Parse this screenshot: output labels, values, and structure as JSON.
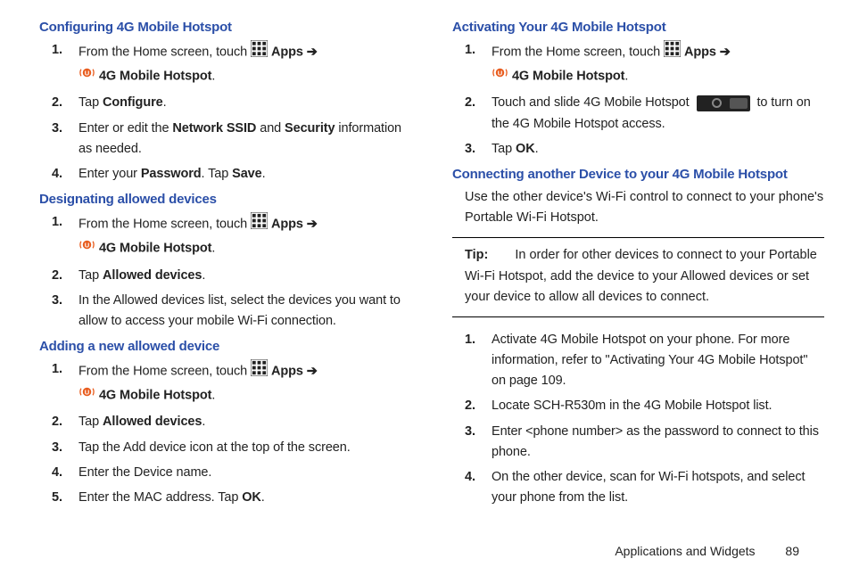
{
  "left": {
    "sec1": {
      "title": "Configuring 4G Mobile Hotspot",
      "s1a": "From the Home screen, touch ",
      "apps": "Apps",
      "arrow": "➔",
      "hotspot": "4G Mobile Hotspot",
      "s2a": "Tap ",
      "s2b": "Configure",
      "s3a": "Enter or edit the ",
      "s3b": "Network SSID",
      "s3c": " and ",
      "s3d": "Security",
      "s3e": " information as needed.",
      "s4a": "Enter your ",
      "s4b": "Password",
      "s4c": ". Tap ",
      "s4d": "Save"
    },
    "sec2": {
      "title": "Designating allowed devices",
      "s1a": "From the Home screen, touch ",
      "apps": "Apps",
      "arrow": "➔",
      "hotspot": "4G Mobile Hotspot",
      "s2a": "Tap ",
      "s2b": "Allowed devices",
      "s3": "In the Allowed devices list, select the devices you want to allow to access your mobile Wi-Fi connection."
    },
    "sec3": {
      "title": "Adding a new allowed device",
      "s1a": "From the Home screen, touch ",
      "apps": "Apps",
      "arrow": "➔",
      "hotspot": "4G Mobile Hotspot",
      "s2a": "Tap ",
      "s2b": "Allowed devices",
      "s3": "Tap the Add device icon at the top of the screen.",
      "s4": "Enter the Device name.",
      "s5a": "Enter the MAC address. Tap ",
      "s5b": "OK"
    }
  },
  "right": {
    "sec1": {
      "title": "Activating Your 4G Mobile Hotspot",
      "s1a": "From the Home screen, touch ",
      "apps": "Apps",
      "arrow": "➔",
      "hotspot": "4G Mobile Hotspot",
      "s2a": "Touch and slide 4G Mobile Hotspot ",
      "s2b": " to turn on the 4G Mobile Hotspot access.",
      "s3a": "Tap ",
      "s3b": "OK"
    },
    "sec2": {
      "title": "Connecting another Device to your 4G Mobile Hotspot",
      "body": "Use the other device's Wi-Fi control to connect to your phone's Portable Wi-Fi Hotspot."
    },
    "tip": {
      "label": "Tip:",
      "body": "In order for other devices to connect to your Portable Wi-Fi Hotspot, add the device to your Allowed devices or set your device to allow all devices to connect."
    },
    "sec3": {
      "s1": "Activate 4G Mobile Hotspot on your phone. For more information, refer to \"Activating Your 4G Mobile Hotspot\" on page 109.",
      "s2": "Locate SCH-R530m in the 4G Mobile Hotspot list.",
      "s3": "Enter <phone number> as the password to connect to this phone.",
      "s4": "On the other device, scan for Wi-Fi hotspots, and select your phone from the list."
    }
  },
  "footer": {
    "section": "Applications and Widgets",
    "page": "89"
  },
  "nums": {
    "n1": "1.",
    "n2": "2.",
    "n3": "3.",
    "n4": "4.",
    "n5": "5."
  },
  "period": "."
}
